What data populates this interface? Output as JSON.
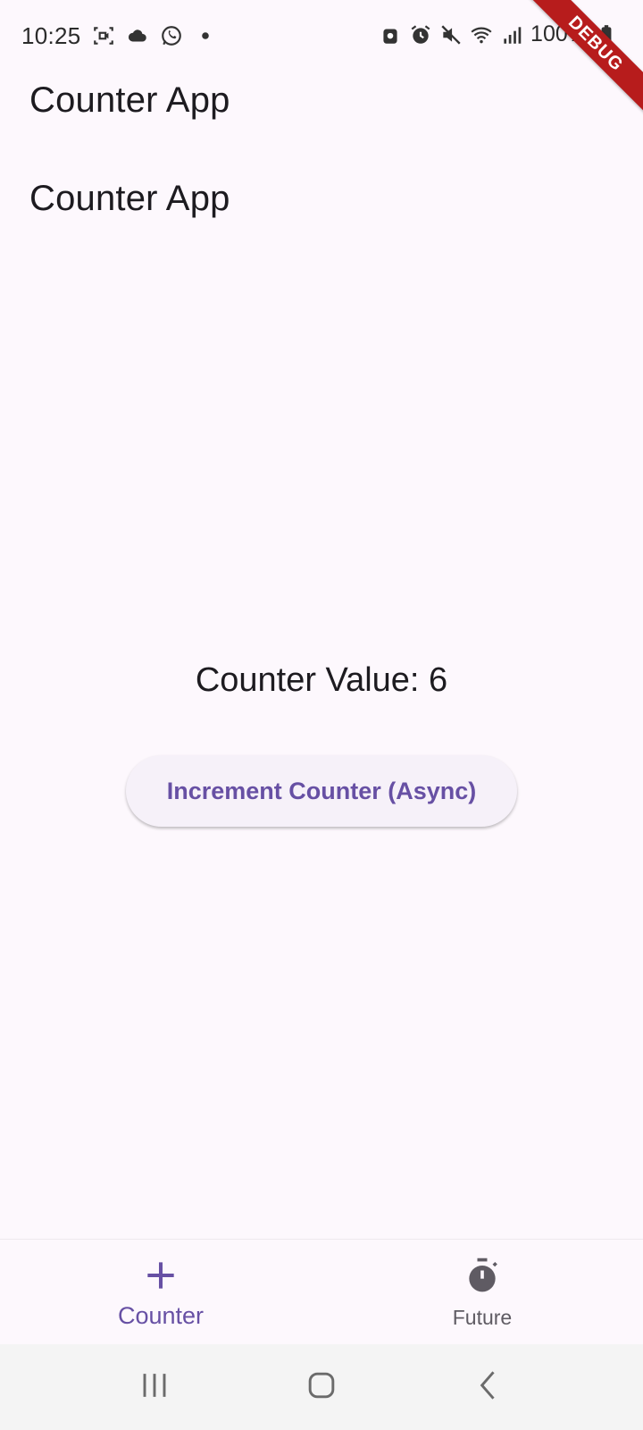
{
  "status_bar": {
    "time": "10:25",
    "battery_text": "100%",
    "left_icons": [
      "screen-record-icon",
      "cloud-icon",
      "whatsapp-icon",
      "dot-icon"
    ],
    "right_icons": [
      "lock-icon",
      "alarm-icon",
      "mute-icon",
      "wifi-icon",
      "signal-icon",
      "battery-icon"
    ]
  },
  "debug_banner": {
    "label": "DEBUG",
    "color": "#b71c1c"
  },
  "app_bar": {
    "title": "Counter App"
  },
  "body": {
    "heading": "Counter App",
    "counter_value_text": "Counter Value: 6",
    "increment_button_label": "Increment Counter (Async)"
  },
  "bottom_nav": {
    "items": [
      {
        "label": "Counter",
        "icon": "plus-icon",
        "selected": true
      },
      {
        "label": "Future",
        "icon": "timer-icon",
        "selected": false
      }
    ]
  },
  "system_nav": {
    "buttons": [
      "recents-icon",
      "home-icon",
      "back-icon"
    ]
  },
  "colors": {
    "accent": "#6750a4",
    "background": "#fdf8fd",
    "button_bg": "#f6f1f9",
    "text": "#1d1b20"
  }
}
